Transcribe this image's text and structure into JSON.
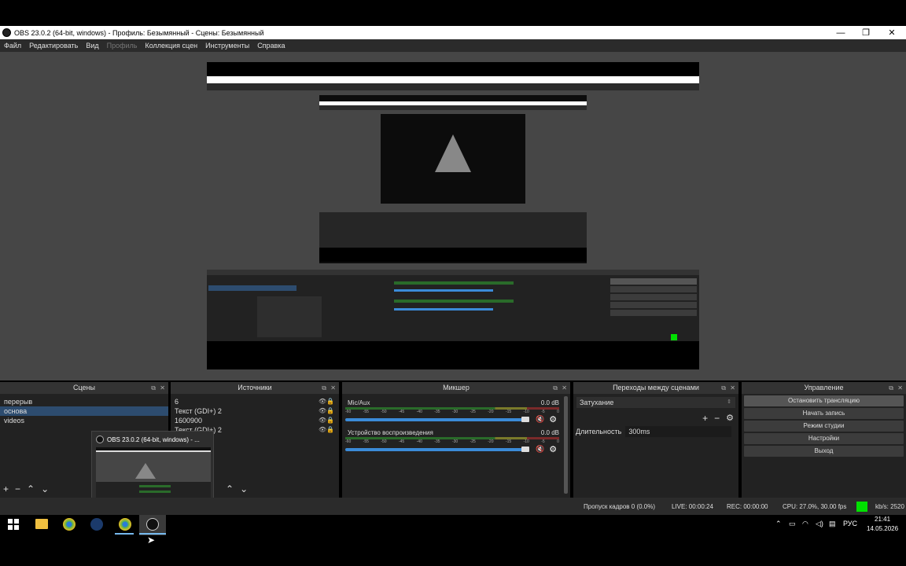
{
  "window": {
    "title": "OBS 23.0.2 (64-bit, windows) - Профиль: Безымянный - Сцены: Безымянный",
    "minimize": "—",
    "maximize": "❐",
    "close": "✕"
  },
  "menu": [
    "Файл",
    "Редактировать",
    "Вид",
    "Профиль",
    "Коллекция сцен",
    "Инструменты",
    "Справка"
  ],
  "scenes": {
    "title": "Сцены",
    "items": [
      "перерыв",
      "основа",
      "videos"
    ],
    "selected_index": 1
  },
  "sources": {
    "title": "Источники",
    "items": [
      "6",
      "Текст (GDI+) 2",
      "1600900",
      "Текст (GDI+) 2"
    ]
  },
  "mixer": {
    "title": "Микшер",
    "tracks": [
      {
        "name": "Mic/Aux",
        "db": "0.0 dB",
        "muted": true
      },
      {
        "name": "Устройство воспроизведения",
        "db": "0.0 dB",
        "muted": true
      }
    ],
    "scale": [
      "-60",
      "-55",
      "-50",
      "-45",
      "-40",
      "-35",
      "-30",
      "-25",
      "-20",
      "-15",
      "-10",
      "-5",
      "0"
    ]
  },
  "transitions": {
    "title": "Переходы между сценами",
    "selected": "Затухание",
    "duration_label": "Длительность",
    "duration_value": "300ms"
  },
  "controls": {
    "title": "Управление",
    "buttons": [
      "Остановить трансляцию",
      "Начать запись",
      "Режим студии",
      "Настройки",
      "Выход"
    ]
  },
  "status": {
    "dropped": "Пропуск кадров 0 (0.0%)",
    "live": "LIVE: 00:00:24",
    "rec": "REC: 00:00:00",
    "cpu": "CPU: 27.0%, 30.00 fps",
    "kbps": "kb/s: 2520",
    "indicator_color": "#00e000"
  },
  "popup": {
    "title": "OBS 23.0.2 (64-bit, windows) - ..."
  },
  "taskbar": {
    "lang": "РУС",
    "time": "21:41",
    "date": "14.05.2026"
  }
}
